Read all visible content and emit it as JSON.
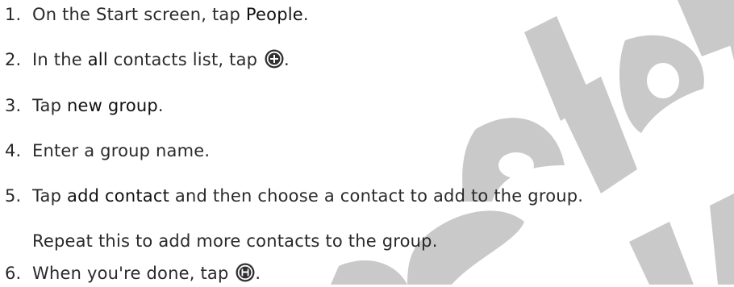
{
  "steps": [
    {
      "num": "1.",
      "pre": "On the Start screen, tap ",
      "kw": "People",
      "post": "."
    },
    {
      "num": "2.",
      "pre": "In the ",
      "kw": "all",
      "mid": " contacts list, tap ",
      "icon": "plus-circle-icon",
      "post": "."
    },
    {
      "num": "3.",
      "pre": "Tap ",
      "kw": "new group",
      "post": "."
    },
    {
      "num": "4.",
      "text": "Enter a group name."
    },
    {
      "num": "5.",
      "pre": "Tap ",
      "kw": "add contact",
      "post": " and then choose a contact to add to the group.",
      "sub": "Repeat this to add more contacts to the group."
    },
    {
      "num": "6.",
      "pre": "When you're done, tap ",
      "icon": "save-circle-icon",
      "post": "."
    }
  ],
  "colors": {
    "text": "#2a2a2a",
    "icon_bg": "#2f2f2f",
    "watermark": "#c9c9c9"
  }
}
